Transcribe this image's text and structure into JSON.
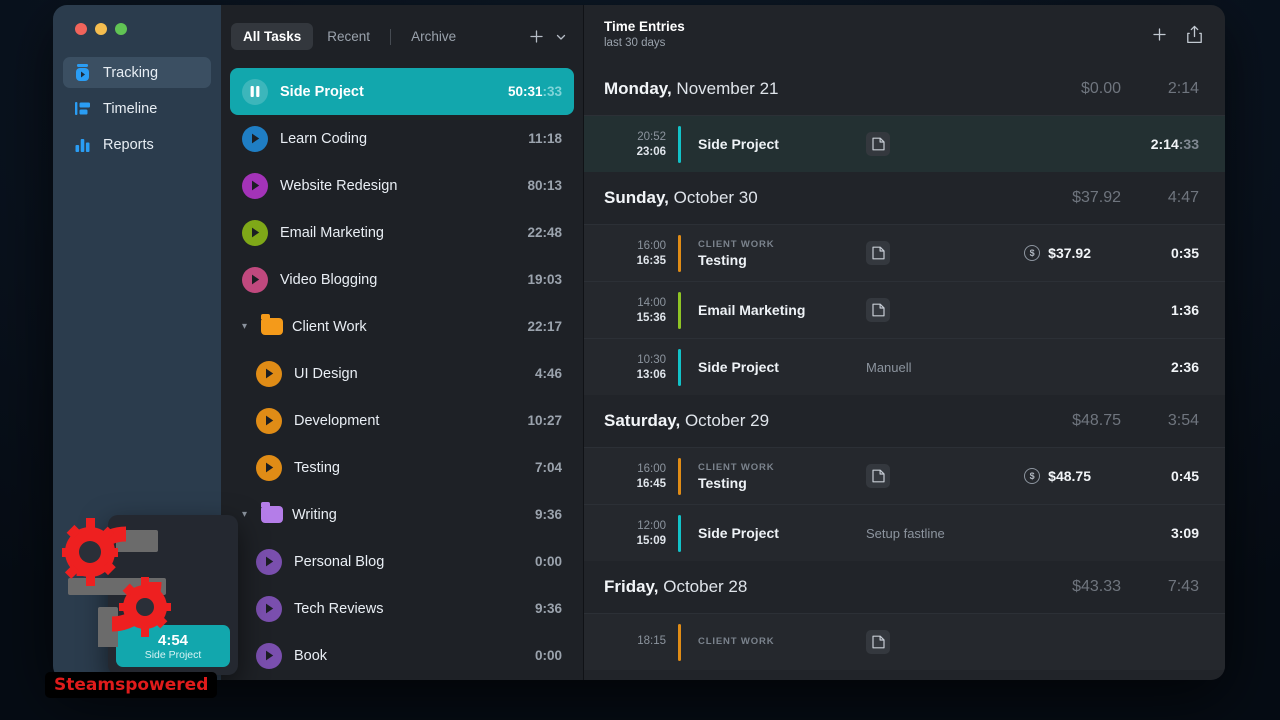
{
  "sidebar": {
    "traffic_lights": [
      "close",
      "minimize",
      "maximize"
    ],
    "items": [
      {
        "label": "Tracking",
        "icon": "tracking-timer-icon",
        "active": true
      },
      {
        "label": "Timeline",
        "icon": "timeline-icon",
        "active": false
      },
      {
        "label": "Reports",
        "icon": "bar-chart-icon",
        "active": false
      }
    ]
  },
  "tasks_panel": {
    "tabs": [
      {
        "label": "All Tasks",
        "active": true
      },
      {
        "label": "Recent",
        "active": false
      },
      {
        "label": "Archive",
        "active": false
      }
    ],
    "add_icon": "plus-icon",
    "dropdown_icon": "chevron-down-icon",
    "items": [
      {
        "type": "task",
        "name": "Side Project",
        "time": "50:31",
        "seconds": ":33",
        "color": "#12a7ad",
        "playing": true,
        "child": false
      },
      {
        "type": "task",
        "name": "Learn Coding",
        "time": "11:18",
        "seconds": "",
        "color": "#1f7ec4",
        "playing": false,
        "child": false
      },
      {
        "type": "task",
        "name": "Website Redesign",
        "time": "80:13",
        "seconds": "",
        "color": "#a333b8",
        "playing": false,
        "child": false
      },
      {
        "type": "task",
        "name": "Email Marketing",
        "time": "22:48",
        "seconds": "",
        "color": "#7fa818",
        "playing": false,
        "child": false
      },
      {
        "type": "task",
        "name": "Video Blogging",
        "time": "19:03",
        "seconds": "",
        "color": "#c0497e",
        "playing": false,
        "child": false
      },
      {
        "type": "folder",
        "name": "Client Work",
        "time": "22:17",
        "color": "#f49a1a",
        "expanded": true
      },
      {
        "type": "task",
        "name": "UI Design",
        "time": "4:46",
        "seconds": "",
        "color": "#e08c16",
        "playing": false,
        "child": true
      },
      {
        "type": "task",
        "name": "Development",
        "time": "10:27",
        "seconds": "",
        "color": "#e08c16",
        "playing": false,
        "child": true
      },
      {
        "type": "task",
        "name": "Testing",
        "time": "7:04",
        "seconds": "",
        "color": "#e08c16",
        "playing": false,
        "child": true
      },
      {
        "type": "folder",
        "name": "Writing",
        "time": "9:36",
        "color": "#b47de8",
        "expanded": true
      },
      {
        "type": "task",
        "name": "Personal Blog",
        "time": "0:00",
        "seconds": "",
        "color": "#7a4fae",
        "playing": false,
        "child": true
      },
      {
        "type": "task",
        "name": "Tech Reviews",
        "time": "9:36",
        "seconds": "",
        "color": "#7a4fae",
        "playing": false,
        "child": true
      },
      {
        "type": "task",
        "name": "Book",
        "time": "0:00",
        "seconds": "",
        "color": "#7a4fae",
        "playing": false,
        "child": true
      }
    ]
  },
  "entries_panel": {
    "title": "Time Entries",
    "subtitle": "last 30 days",
    "add_icon": "plus-icon",
    "share_icon": "share-icon",
    "days": [
      {
        "weekday": "Monday,",
        "date": "November 21",
        "money": "$0.00",
        "duration": "2:14",
        "entries": [
          {
            "start": "20:52",
            "end": "23:06",
            "tag": "",
            "project": "Side Project",
            "note": "",
            "has_doc": true,
            "money": "",
            "billable": false,
            "duration": "2:14",
            "seconds": ":33",
            "color": "#12c2c8",
            "active": true
          }
        ]
      },
      {
        "weekday": "Sunday,",
        "date": "October 30",
        "money": "$37.92",
        "duration": "4:47",
        "entries": [
          {
            "start": "16:00",
            "end": "16:35",
            "tag": "CLIENT WORK",
            "project": "Testing",
            "note": "",
            "has_doc": true,
            "money": "$37.92",
            "billable": true,
            "duration": "0:35",
            "seconds": "",
            "color": "#e08c16",
            "active": false
          },
          {
            "start": "14:00",
            "end": "15:36",
            "tag": "",
            "project": "Email Marketing",
            "note": "",
            "has_doc": true,
            "money": "",
            "billable": false,
            "duration": "1:36",
            "seconds": "",
            "color": "#8fc425",
            "active": false
          },
          {
            "start": "10:30",
            "end": "13:06",
            "tag": "",
            "project": "Side Project",
            "note": "Manuell",
            "has_doc": false,
            "money": "",
            "billable": false,
            "duration": "2:36",
            "seconds": "",
            "color": "#12c2c8",
            "active": false
          }
        ]
      },
      {
        "weekday": "Saturday,",
        "date": "October 29",
        "money": "$48.75",
        "duration": "3:54",
        "entries": [
          {
            "start": "16:00",
            "end": "16:45",
            "tag": "CLIENT WORK",
            "project": "Testing",
            "note": "",
            "has_doc": true,
            "money": "$48.75",
            "billable": true,
            "duration": "0:45",
            "seconds": "",
            "color": "#e08c16",
            "active": false
          },
          {
            "start": "12:00",
            "end": "15:09",
            "tag": "",
            "project": "Side Project",
            "note": "Setup fastline",
            "has_doc": false,
            "money": "",
            "billable": false,
            "duration": "3:09",
            "seconds": "",
            "color": "#12c2c8",
            "active": false
          }
        ]
      },
      {
        "weekday": "Friday,",
        "date": "October 28",
        "money": "$43.33",
        "duration": "7:43",
        "entries": [
          {
            "start": "18:15",
            "end": "",
            "tag": "CLIENT WORK",
            "project": "",
            "note": "",
            "has_doc": true,
            "money": "",
            "billable": true,
            "duration": "",
            "seconds": "",
            "color": "#e08c16",
            "active": false
          }
        ]
      }
    ]
  },
  "floating_timer": {
    "time": "4:54",
    "project": "Side Project",
    "accent": "#12a7ad"
  },
  "watermark": {
    "label": "Steamspowered",
    "color": "#e01b1b"
  }
}
